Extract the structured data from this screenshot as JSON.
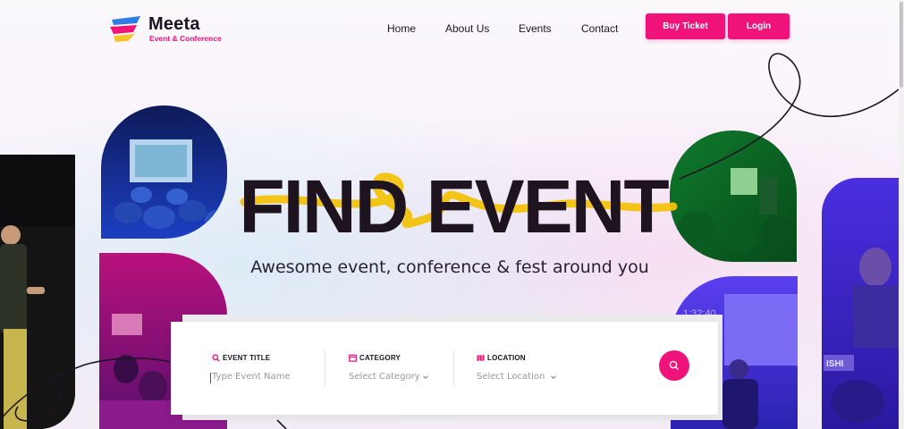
{
  "brand": {
    "name": "Meeta",
    "tagline": "Event & Conference",
    "accent_color": "#f0147a"
  },
  "nav": {
    "items": [
      {
        "label": "Home"
      },
      {
        "label": "About Us"
      },
      {
        "label": "Events"
      },
      {
        "label": "Contact"
      }
    ],
    "buy_ticket_label": "Buy Ticket",
    "login_label": "Login"
  },
  "hero": {
    "title": "FIND EVENT",
    "subtitle": "Awesome event, conference & fest around you"
  },
  "search": {
    "event_title_label": "EVENT TITLE",
    "event_title_placeholder": "Type Event Name",
    "category_label": "CATEGORY",
    "category_value": "Select Category",
    "location_label": "LOCATION",
    "location_value": "Select Location",
    "icons": {
      "event_title": "search-icon",
      "category": "calendar-icon",
      "location": "map-icon",
      "submit": "search-icon"
    }
  },
  "photo_overlay_text": {
    "timer": "1:32:40",
    "sign": "ISHI"
  }
}
